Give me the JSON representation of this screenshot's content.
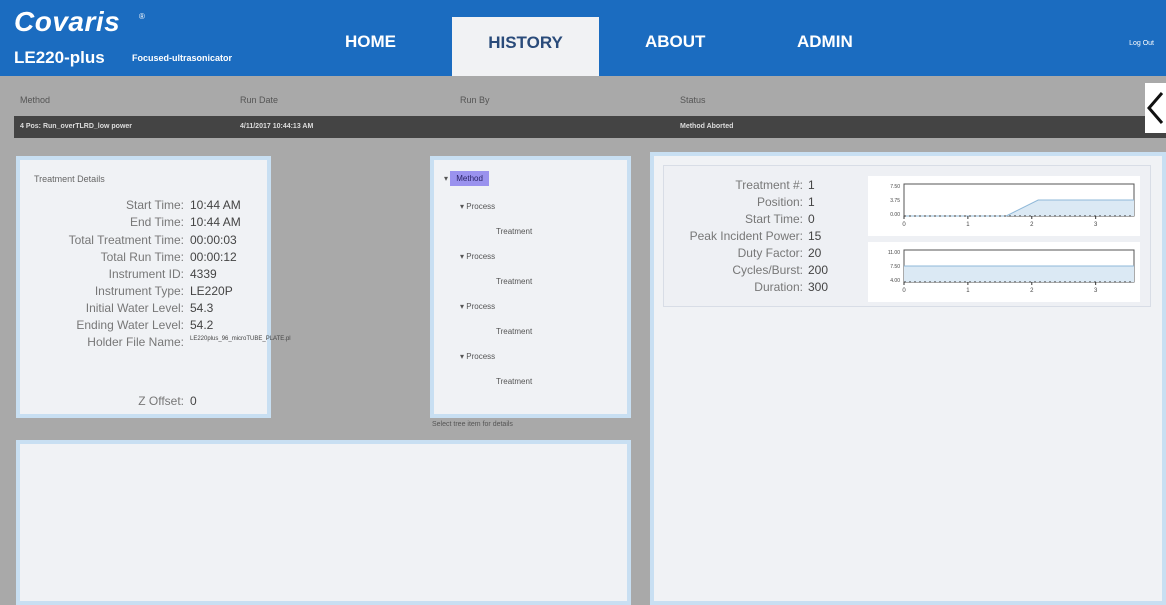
{
  "header": {
    "brand": "Covaris",
    "brand_mark": "®",
    "model": "LE220-plus",
    "model_sub": "Focused-ultrasonicator",
    "nav": [
      "HOME",
      "HISTORY",
      "ABOUT",
      "ADMIN"
    ],
    "active_nav": "HISTORY",
    "logout": "Log Out"
  },
  "run_table": {
    "columns": [
      "Method",
      "Run Date",
      "Run By",
      "Status"
    ],
    "row": {
      "method": "4 Pos: Run_overTLRD_low power",
      "run_date": "4/11/2017 10:44:13 AM",
      "run_by": "",
      "status": "Method Aborted"
    }
  },
  "treatment_details": {
    "title": "Treatment Details",
    "fields": [
      {
        "label": "Start Time:",
        "value": "10:44 AM"
      },
      {
        "label": "End Time:",
        "value": "10:44 AM"
      },
      {
        "label": "Total Treatment Time:",
        "value": "00:00:03"
      },
      {
        "label": "Total Run Time:",
        "value": "00:00:12"
      },
      {
        "label": "Instrument ID:",
        "value": "4339"
      },
      {
        "label": "Instrument Type:",
        "value": "LE220P"
      },
      {
        "label": "Initial Water Level:",
        "value": "54.3"
      },
      {
        "label": "Ending Water Level:",
        "value": "54.2"
      },
      {
        "label": "Holder File Name:",
        "value": "LE220plus_96_microTUBE_PLATE.pl"
      },
      {
        "label": "Z Offset:",
        "value": "0"
      }
    ]
  },
  "tree": {
    "root": "Method",
    "items": [
      {
        "process": "Process",
        "treatment": "Treatment"
      },
      {
        "process": "Process",
        "treatment": "Treatment"
      },
      {
        "process": "Process",
        "treatment": "Treatment"
      },
      {
        "process": "Process",
        "treatment": "Treatment"
      }
    ],
    "hint": "Select tree item for details"
  },
  "treatment_params": {
    "fields": [
      {
        "label": "Treatment #:",
        "value": "1"
      },
      {
        "label": "Position:",
        "value": "1"
      },
      {
        "label": "Start Time:",
        "value": "0"
      },
      {
        "label": "Peak Incident Power:",
        "value": "15"
      },
      {
        "label": "Duty Factor:",
        "value": "20"
      },
      {
        "label": "Cycles/Burst:",
        "value": "200"
      },
      {
        "label": "Duration:",
        "value": "300"
      }
    ]
  },
  "chart_data": [
    {
      "type": "area",
      "ylabel": "AIP W",
      "yticks": [
        "7.50",
        "3.75",
        "0.00"
      ],
      "xticks": [
        "0",
        "1",
        "2",
        "3"
      ],
      "ylim": [
        0,
        7.5
      ],
      "x": [
        0,
        1.6,
        2.1,
        3.6
      ],
      "values": [
        0,
        0,
        3.75,
        3.75
      ],
      "colors": {
        "line": "#8fb8d8",
        "fill": "#dbe9f4"
      }
    },
    {
      "type": "area",
      "ylabel": "°C",
      "yticks": [
        "11.00",
        "7.50",
        "4.00"
      ],
      "xticks": [
        "0",
        "1",
        "2",
        "3"
      ],
      "ylim": [
        4,
        11
      ],
      "x": [
        0,
        3.6
      ],
      "values": [
        7.5,
        7.5
      ],
      "colors": {
        "line": "#8fb8d8",
        "fill": "#dbe9f4"
      }
    }
  ],
  "colors": {
    "header_blue": "#1b6cc0",
    "panel_border": "#c8dff2",
    "panel_bg": "#f0f2f5",
    "selected": "#9a92ee",
    "runbar": "#444444"
  }
}
